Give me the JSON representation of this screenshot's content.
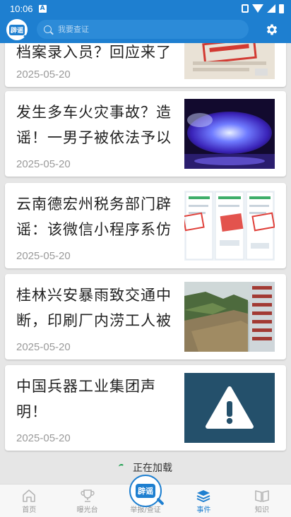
{
  "status_bar": {
    "time": "10:06",
    "notif_icon": "A"
  },
  "header": {
    "logo_text": "辟谣",
    "search_placeholder": "我要查证",
    "settings_icon": "gear-icon"
  },
  "feed": {
    "cards": [
      {
        "title": "档案录入员？回应来了",
        "date": "2025-05-20",
        "thumb": "stamped-document"
      },
      {
        "title": "发生多车火灾事故？造谣！一男子被依法予以",
        "date": "2025-05-20",
        "thumb": "police-light"
      },
      {
        "title": "云南德宏州税务部门辟谣：该微信小程序系仿",
        "date": "2025-05-20",
        "thumb": "phone-screenshots-rumor-stamp"
      },
      {
        "title": "桂林兴安暴雨致交通中断，印刷厂内涝工人被",
        "date": "2025-05-20",
        "thumb": "flooded-street"
      },
      {
        "title": "中国兵器工业集团声明！",
        "date": "2025-05-20",
        "thumb": "warning-icon"
      }
    ],
    "loading_text": "正在加载"
  },
  "tab_bar": {
    "tabs": [
      {
        "label": "首页",
        "icon": "home-icon"
      },
      {
        "label": "曝光台",
        "icon": "trophy-icon"
      },
      {
        "label": "举报/查证",
        "icon": "search-logo-icon"
      },
      {
        "label": "事件",
        "icon": "layers-icon",
        "active": true
      },
      {
        "label": "知识",
        "icon": "book-icon"
      }
    ]
  },
  "colors": {
    "brand": "#1e7fd0",
    "background": "#e6e6e6",
    "date": "#9a9a9a",
    "loading_spinner": "#1a9e4c"
  }
}
